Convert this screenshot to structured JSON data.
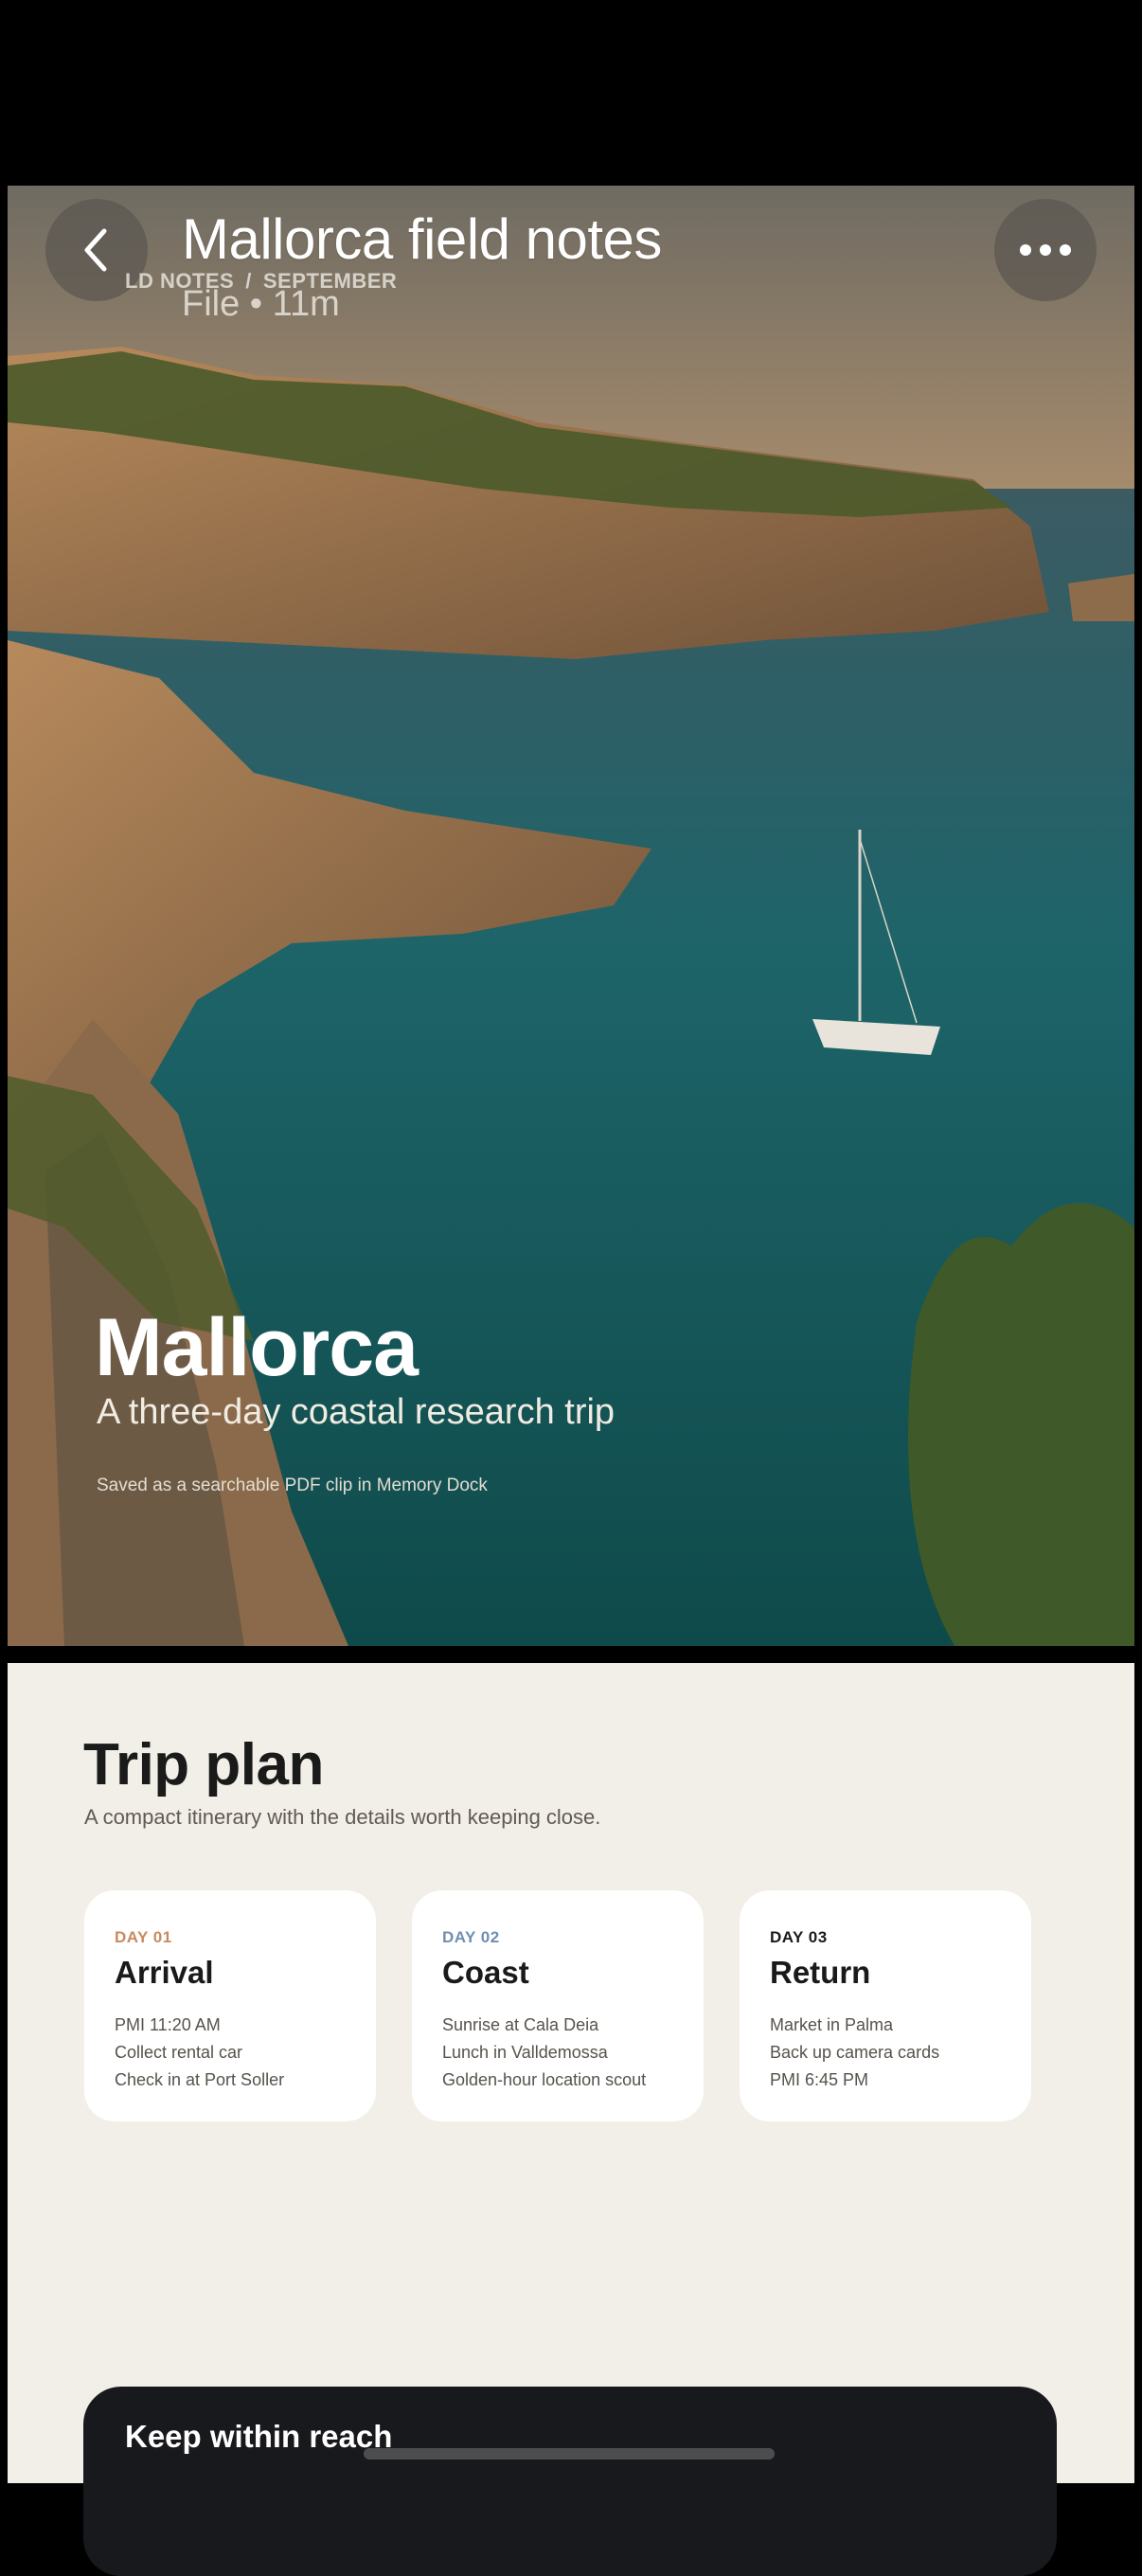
{
  "nav": {
    "title": "Mallorca field notes",
    "breadcrumb": [
      "LD NOTES",
      "SEPTEMBER"
    ],
    "breadcrumb_separator": "/",
    "file_meta": "File • 11m",
    "back_icon": "chevron-left-icon",
    "more_icon": "more-horizontal-icon"
  },
  "hero": {
    "title": "Mallorca",
    "subtitle": "A three-day coastal research trip",
    "caption": "Saved as a searchable PDF clip in Memory Dock"
  },
  "plan": {
    "heading": "Trip plan",
    "subheading": "A compact itinerary with the details worth keeping close.",
    "days": [
      {
        "day": "DAY 01",
        "title": "Arrival",
        "accent": "#c98a5e",
        "items": [
          "PMI 11:20 AM",
          "Collect rental car",
          "Check in at Port Soller"
        ]
      },
      {
        "day": "DAY 02",
        "title": "Coast",
        "accent": "#6f8fb0",
        "items": [
          "Sunrise at Cala Deia",
          "Lunch in Valldemossa",
          "Golden-hour location scout"
        ]
      },
      {
        "day": "DAY 03",
        "title": "Return",
        "accent": "#1a1a1a",
        "items": [
          "Market in Palma",
          "Back up camera cards",
          "PMI 6:45 PM"
        ]
      }
    ]
  },
  "reach": {
    "title": "Keep within reach"
  }
}
